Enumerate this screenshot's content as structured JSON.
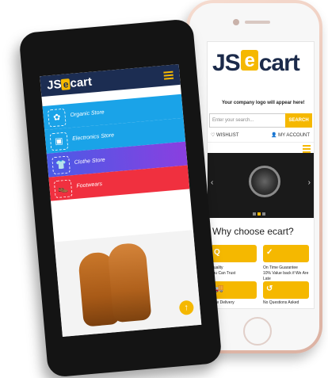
{
  "iphone": {
    "logo": {
      "prefix": "JS",
      "bag_letter": "e",
      "suffix": "cart"
    },
    "tagline": "Your company logo will appear here!",
    "search": {
      "placeholder": "Enter your search...",
      "button": "SEARCH"
    },
    "wishlist": "♡ WISHLIST",
    "account": "👤 MY ACCOUNT",
    "banner": {
      "prev": "‹",
      "next": "›"
    },
    "why_title": "Why choose ecart?",
    "features": [
      {
        "icon": "Q",
        "label": "Quality\nyou Can Trust"
      },
      {
        "icon": "✓",
        "label": "On Time Guarantee\n10% Value back if We Are Late"
      },
      {
        "icon": "🚚",
        "label": "Free Delivery"
      },
      {
        "icon": "↺",
        "label": "No Questions Asked"
      }
    ]
  },
  "android": {
    "logo": {
      "prefix": "JS",
      "bag_letter": "e",
      "suffix": "cart"
    },
    "categories": [
      {
        "label": "Organic Store",
        "color": "#1aa3e8",
        "icon": "basket-icon"
      },
      {
        "label": "Electronics Store",
        "color": "#1aa3e8",
        "icon": "appliance-icon"
      },
      {
        "label": "Clothe Store",
        "color": "#7b3fe4",
        "icon": "shirt-icon"
      },
      {
        "label": "Footwears",
        "color": "#f0303f",
        "icon": "shoe-icon"
      }
    ],
    "fab": "↑"
  },
  "colors": {
    "accent": "#f5b800",
    "header": "#1c2d52"
  }
}
